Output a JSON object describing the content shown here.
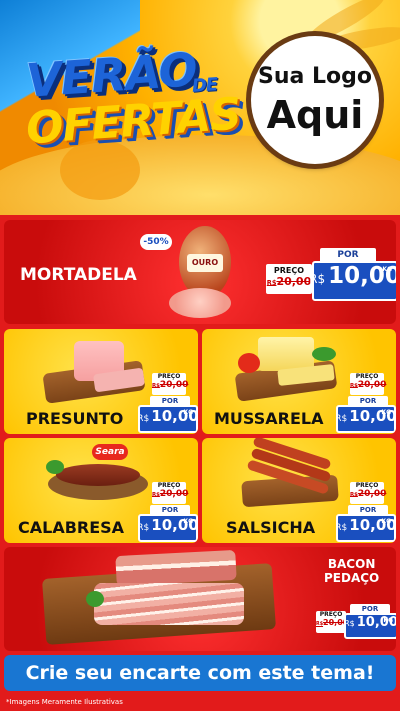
{
  "header": {
    "title_line1": "VERÃO",
    "title_de": "DE",
    "title_line2": "OFERTAS",
    "logo_line1": "Sua Logo",
    "logo_line2": "Aqui"
  },
  "featured": {
    "name": "MORTADELA",
    "discount_badge": "-50%",
    "brand_label": "OURO",
    "old_label": "PREÇO",
    "old_currency": "R$",
    "old_price": "20,00",
    "new_label": "POR",
    "new_currency": "R$",
    "new_price": "10,00",
    "unit": "KG"
  },
  "grid": [
    {
      "name": "PRESUNTO",
      "old_label": "PREÇO",
      "old_currency": "R$",
      "old_price": "20,00",
      "new_label": "POR",
      "new_currency": "R$",
      "new_price": "10,00",
      "unit": "KG"
    },
    {
      "name": "MUSSARELA",
      "old_label": "PREÇO",
      "old_currency": "R$",
      "old_price": "20,00",
      "new_label": "POR",
      "new_currency": "R$",
      "new_price": "10,00",
      "unit": "KG"
    },
    {
      "name": "CALABRESA",
      "brand_label": "Seara",
      "old_label": "PREÇO",
      "old_currency": "R$",
      "old_price": "20,00",
      "new_label": "POR",
      "new_currency": "R$",
      "new_price": "10,00",
      "unit": "KG"
    },
    {
      "name": "SALSICHA",
      "old_label": "PREÇO",
      "old_currency": "R$",
      "old_price": "20,00",
      "new_label": "POR",
      "new_currency": "R$",
      "new_price": "10,00",
      "unit": "KG"
    }
  ],
  "bottom": {
    "name_line1": "BACON",
    "name_line2": "PEDAÇO",
    "old_label": "PREÇO",
    "old_currency": "R$",
    "old_price": "20,00",
    "new_label": "POR",
    "new_currency": "R$",
    "new_price": "10,00",
    "unit": "KG"
  },
  "footer": {
    "cta": "Crie seu encarte com este tema!",
    "disclaimer": "*Imagens Meramente Ilustrativas"
  },
  "colors": {
    "red": "#e21b1b",
    "yellow": "#ffc400",
    "blue": "#1a4fbf",
    "cta_blue": "#1976d2"
  }
}
